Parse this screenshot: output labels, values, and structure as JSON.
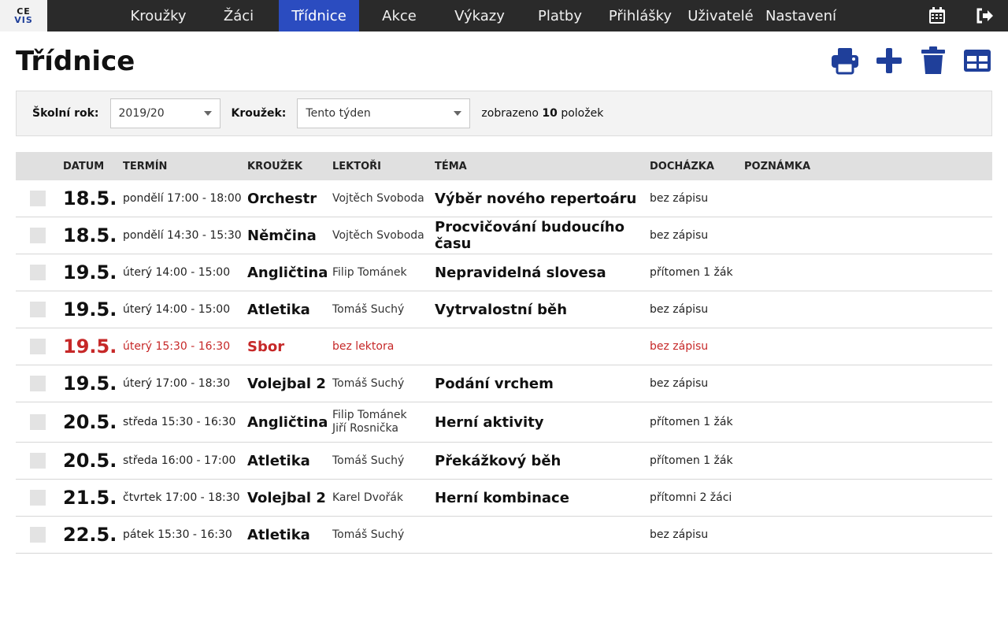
{
  "logo": {
    "line1": "CE",
    "line2": "VIS"
  },
  "nav": {
    "items": [
      {
        "label": "Kroužky"
      },
      {
        "label": "Žáci"
      },
      {
        "label": "Třídnice"
      },
      {
        "label": "Akce"
      },
      {
        "label": "Výkazy"
      },
      {
        "label": "Platby"
      },
      {
        "label": "Přihlášky"
      },
      {
        "label": "Uživatelé"
      },
      {
        "label": "Nastavení"
      }
    ],
    "active_index": 2
  },
  "top_icons": [
    "calendar-icon",
    "logout-icon"
  ],
  "page": {
    "title": "Třídnice"
  },
  "actions": [
    "print-icon",
    "add-icon",
    "delete-icon",
    "grid-view-icon"
  ],
  "filters": {
    "year_label": "Školní rok:",
    "year_value": "2019/20",
    "club_label": "Kroužek:",
    "club_value": "Tento týden",
    "count_prefix": "zobrazeno",
    "count_value": "10",
    "count_suffix": "položek"
  },
  "table": {
    "headers": [
      "DATUM",
      "TERMÍN",
      "KROUŽEK",
      "LEKTOŘI",
      "TÉMA",
      "DOCHÁZKA",
      "POZNÁMKA"
    ],
    "rows": [
      {
        "date": "18.5.",
        "term": "pondělí 17:00 - 18:00",
        "club": "Orchestr",
        "lectors": [
          "Vojtěch Svoboda"
        ],
        "topic": "Výběr nového repertoáru",
        "attendance": "bez zápisu",
        "note": ""
      },
      {
        "date": "18.5.",
        "term": "pondělí 14:30 - 15:30",
        "club": "Němčina",
        "lectors": [
          "Vojtěch Svoboda"
        ],
        "topic": "Procvičování budoucího času",
        "attendance": "bez zápisu",
        "note": ""
      },
      {
        "date": "19.5.",
        "term": "úterý 14:00 - 15:00",
        "club": "Angličtina",
        "lectors": [
          "Filip Tománek"
        ],
        "topic": "Nepravidelná slovesa",
        "attendance": "přítomen 1 žák",
        "note": ""
      },
      {
        "date": "19.5.",
        "term": "úterý 14:00 - 15:00",
        "club": "Atletika",
        "lectors": [
          "Tomáš Suchý"
        ],
        "topic": "Vytrvalostní běh",
        "attendance": "bez zápisu",
        "note": ""
      },
      {
        "date": "19.5.",
        "term": "úterý 15:30 - 16:30",
        "club": "Sbor",
        "lectors": [
          "bez lektora"
        ],
        "topic": "",
        "attendance": "bez zápisu",
        "note": "",
        "missing": true
      },
      {
        "date": "19.5.",
        "term": "úterý 17:00 - 18:30",
        "club": "Volejbal 2",
        "lectors": [
          "Tomáš Suchý"
        ],
        "topic": "Podání vrchem",
        "attendance": "bez zápisu",
        "note": ""
      },
      {
        "date": "20.5.",
        "term": "středa 15:30 - 16:30",
        "club": "Angličtina",
        "lectors": [
          "Filip Tománek",
          "Jiří Rosnička"
        ],
        "topic": "Herní aktivity",
        "attendance": "přítomen 1 žák",
        "note": ""
      },
      {
        "date": "20.5.",
        "term": "středa 16:00 - 17:00",
        "club": "Atletika",
        "lectors": [
          "Tomáš Suchý"
        ],
        "topic": "Překážkový běh",
        "attendance": "přítomen 1 žák",
        "note": ""
      },
      {
        "date": "21.5.",
        "term": "čtvrtek 17:00 - 18:30",
        "club": "Volejbal 2",
        "lectors": [
          "Karel Dvořák"
        ],
        "topic": "Herní kombinace",
        "attendance": "přítomni 2 žáci",
        "note": ""
      },
      {
        "date": "22.5.",
        "term": "pátek 15:30 - 16:30",
        "club": "Atletika",
        "lectors": [
          "Tomáš Suchý"
        ],
        "topic": "",
        "attendance": "bez zápisu",
        "note": ""
      }
    ]
  },
  "colors": {
    "accent": "#2b4cc0",
    "icon_blue": "#1f3f9a",
    "warning_red": "#c62828",
    "topbar": "#2a2a2a"
  }
}
